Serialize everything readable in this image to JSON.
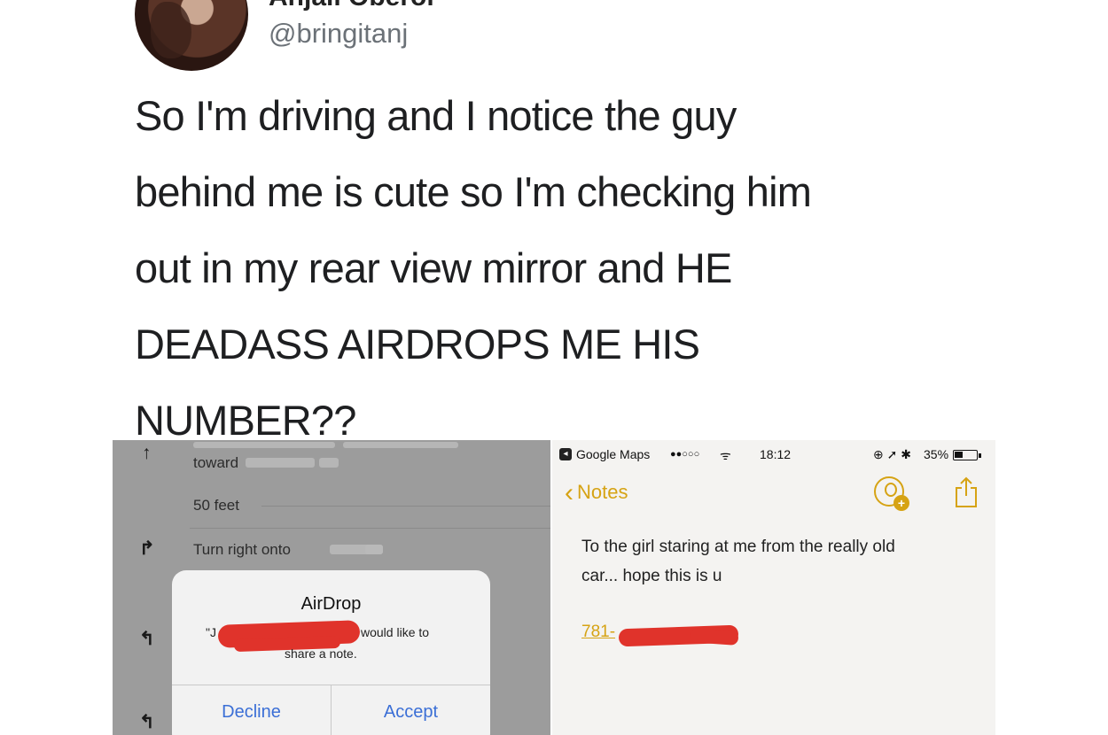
{
  "tweet": {
    "display_name": "Anjali Oberoi",
    "handle": "@bringitanj",
    "lines": [
      "So I'm driving and I notice the guy",
      "behind me is cute so I'm checking him",
      "out in my rear view mirror and HE",
      "DEADASS AIRDROPS ME HIS",
      "NUMBER??"
    ]
  },
  "maps_screenshot": {
    "nav": {
      "row1_text": "toward",
      "row2_distance": "50 feet",
      "row3_text": "Turn right onto"
    },
    "airdrop_dialog": {
      "title": "AirDrop",
      "message_start": "\"J",
      "message_mid": "would like to",
      "message_end": "share a note.",
      "decline_label": "Decline",
      "accept_label": "Accept"
    }
  },
  "notes_screenshot": {
    "status_bar": {
      "app_return": "Google Maps",
      "signal": "●●○○○",
      "time": "18:12",
      "battery_percent": "35%"
    },
    "back_label": "Notes",
    "note_lines": [
      "To the girl staring at me from the really old",
      "car... hope this is u"
    ],
    "phone_prefix": "781-",
    "accent_color": "#d6a314"
  }
}
